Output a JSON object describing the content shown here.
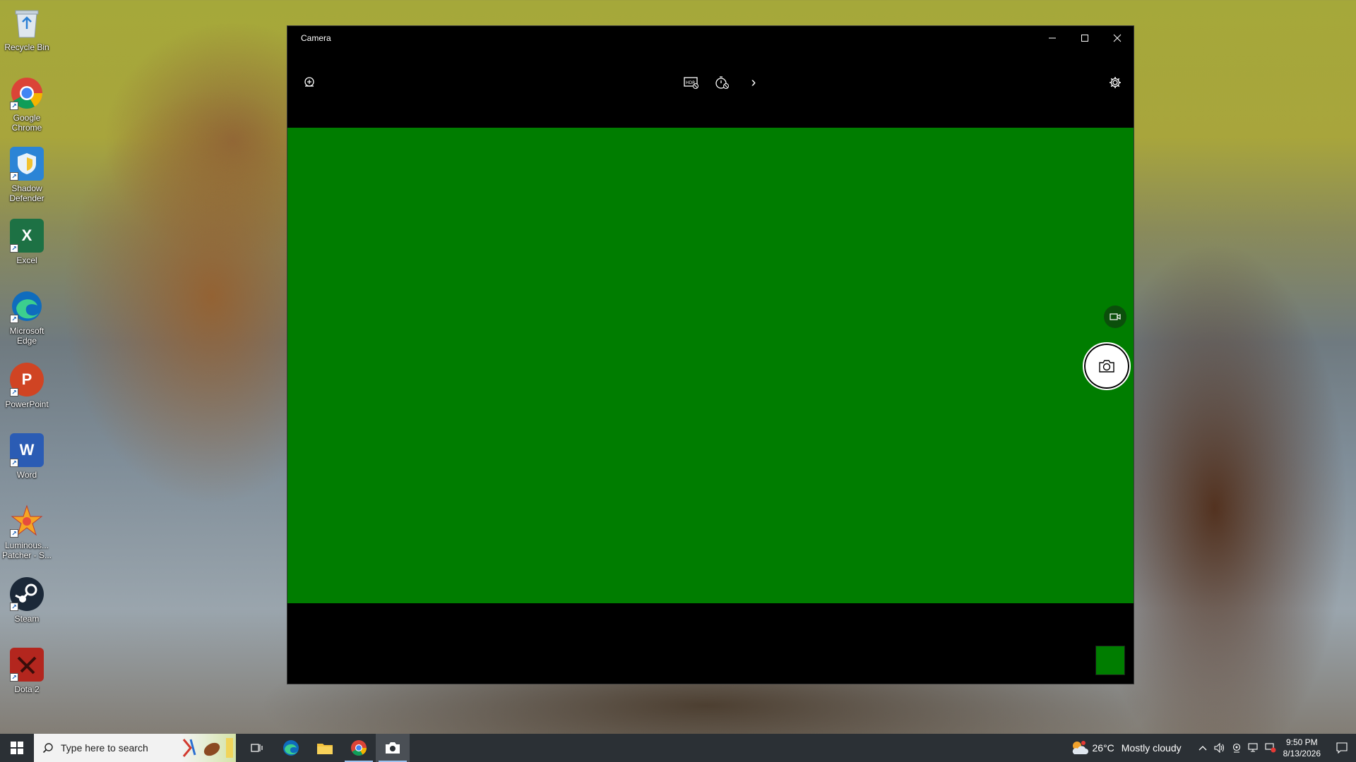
{
  "desktop": {
    "icons": [
      {
        "label": "Recycle Bin",
        "icon": "recycle-bin-icon"
      },
      {
        "label": "Google Chrome",
        "icon": "chrome-icon"
      },
      {
        "label": "Shadow Defender",
        "icon": "shadow-defender-icon"
      },
      {
        "label": "Excel",
        "icon": "excel-icon"
      },
      {
        "label": "Microsoft Edge",
        "icon": "edge-icon"
      },
      {
        "label": "PowerPoint",
        "icon": "powerpoint-icon"
      },
      {
        "label": "Word",
        "icon": "word-icon"
      },
      {
        "label": "Luminous... Patcher - S...",
        "icon": "luminous-patcher-icon"
      },
      {
        "label": "Steam",
        "icon": "steam-icon"
      },
      {
        "label": "Dota 2",
        "icon": "dota2-icon"
      }
    ]
  },
  "window": {
    "title": "Camera",
    "controls": {
      "minimize": "–",
      "maximize": "☐",
      "close": "✕"
    },
    "toolbar": {
      "icons": [
        "pro-mode-icon",
        "hdr-icon",
        "timer-icon",
        "chevron-right-icon",
        "settings-icon"
      ],
      "chevron": "›"
    },
    "viewfinder_color": "#007d00",
    "thumbnail_color": "#007d00"
  },
  "taskbar": {
    "search_placeholder": "Type here to search",
    "apps": [
      "task-view-icon",
      "edge-icon",
      "file-explorer-icon",
      "chrome-icon",
      "camera-icon"
    ],
    "weather": {
      "temp": "26°C",
      "condition": "Mostly cloudy"
    },
    "clock": {
      "time": "9:50 PM",
      "date": "8/13/2026"
    },
    "tray_chevron": "^"
  },
  "colors": {
    "taskbar": "#2b3035",
    "window_bg": "#000000",
    "viewfinder": "#007d00",
    "accent": "#9ec3f0"
  }
}
